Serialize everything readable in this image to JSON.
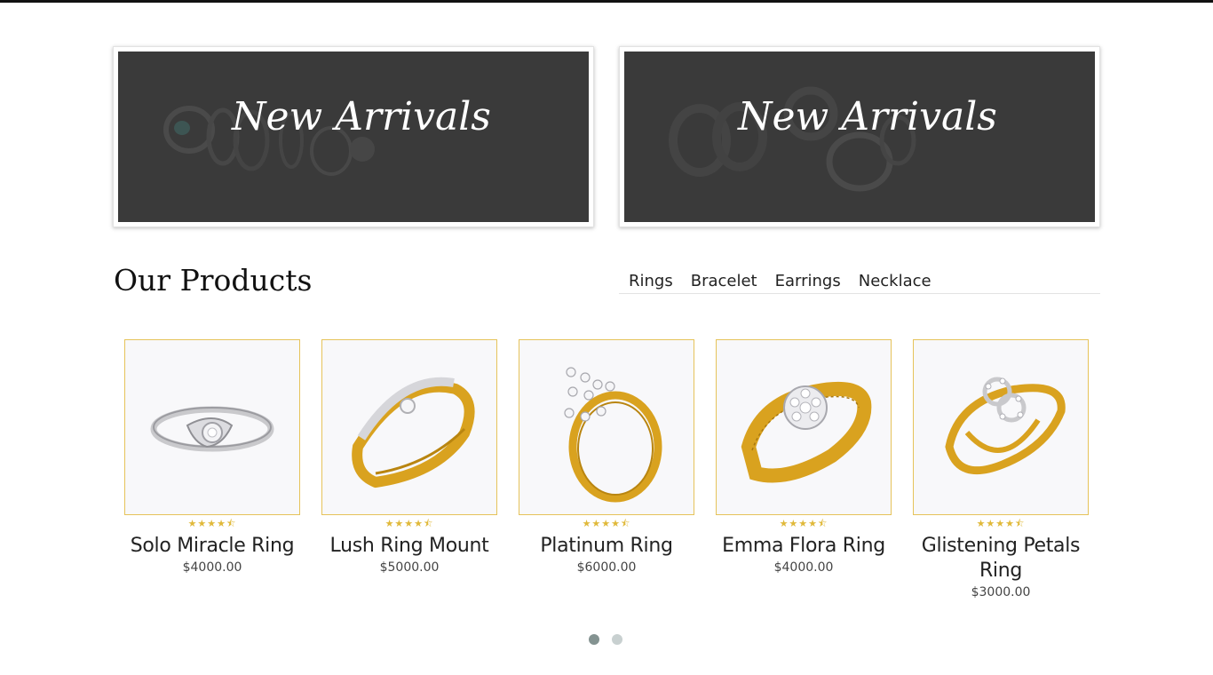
{
  "banners": [
    {
      "title": "New Arrivals",
      "background": "#3a3a3a"
    },
    {
      "title": "New Arrivals",
      "background": "#3a3a3a"
    }
  ],
  "section": {
    "title": "Our Products"
  },
  "tabs": [
    {
      "label": "Rings"
    },
    {
      "label": "Bracelet"
    },
    {
      "label": "Earrings"
    },
    {
      "label": "Necklace"
    }
  ],
  "rating_icons": "★★★★⯪",
  "products": [
    {
      "name": "Solo Miracle Ring",
      "price": "$4000.00",
      "metal": "silver",
      "rating": 4.5
    },
    {
      "name": "Lush Ring Mount",
      "price": "$5000.00",
      "metal": "gold-silver",
      "rating": 4.5
    },
    {
      "name": "Platinum Ring",
      "price": "$6000.00",
      "metal": "gold",
      "rating": 4.5
    },
    {
      "name": "Emma Flora Ring",
      "price": "$4000.00",
      "metal": "gold",
      "rating": 4.5
    },
    {
      "name": "Glistening Petals Ring",
      "price": "$3000.00",
      "metal": "gold",
      "rating": 4.5
    }
  ],
  "carousel": {
    "pages": 2,
    "active": 1
  },
  "colors": {
    "accent": "#e0b93a",
    "card_border": "#e6c35a",
    "gold": "#d9a21f",
    "silver": "#c9c9cc",
    "dot_active": "#849391",
    "dot_inactive": "#c8d0d0"
  }
}
